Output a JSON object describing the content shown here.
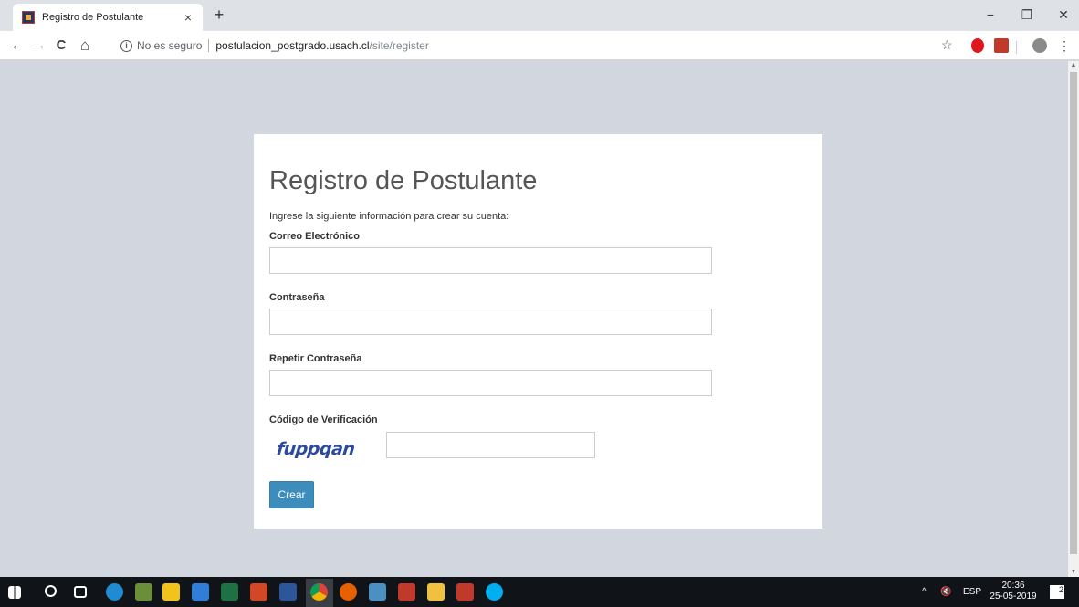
{
  "browser": {
    "tab_title": "Registro de Postulante",
    "tab_close": "×",
    "new_tab": "+",
    "window_controls": {
      "minimize": "−",
      "restore": "❐",
      "close": "✕"
    },
    "nav": {
      "back": "←",
      "forward": "→",
      "reload": "C",
      "home": "⌂"
    },
    "address": {
      "security_label": "No es seguro",
      "host": "postulacion_postgrado.usach.cl",
      "path": "/site/register"
    },
    "bookmark": "☆",
    "menu": "⋮"
  },
  "page": {
    "title": "Registro de Postulante",
    "intro": "Ingrese la siguiente información para crear su cuenta:",
    "fields": {
      "email_label": "Correo Electrónico",
      "email_value": "",
      "password_label": "Contraseña",
      "password_value": "",
      "repeat_password_label": "Repetir Contraseña",
      "repeat_password_value": "",
      "verification_label": "Código de Verificación",
      "captcha_text": "fuppqan",
      "verification_value": ""
    },
    "submit_label": "Crear"
  },
  "taskbar": {
    "tray_arrow": "^",
    "volume": "🔇",
    "language": "ESP",
    "time": "20:36",
    "date": "25-05-2019",
    "notifications_badge": "2"
  },
  "colors": {
    "page_background": "#d2d6de",
    "primary_button": "#3c8dbc",
    "captcha_text": "#2c4a9e"
  }
}
